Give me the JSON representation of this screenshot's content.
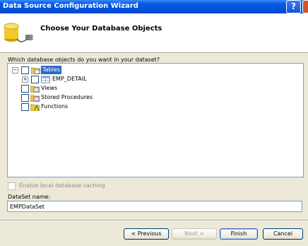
{
  "window": {
    "title": "Data Source Configuration Wizard",
    "help_glyph": "?",
    "close_glyph": "✕"
  },
  "header": {
    "heading": "Choose Your Database Objects",
    "icon": "database-plug-icon"
  },
  "tree": {
    "prompt": "Which database objects do you want in your dataset?",
    "nodes": [
      {
        "label": "Tables",
        "expander": "−",
        "icon": "tables-folder-icon",
        "selected": true
      },
      {
        "label": "EMP_DETAIL",
        "expander": "+",
        "icon": "table-icon"
      },
      {
        "label": "Views",
        "icon": "views-folder-icon"
      },
      {
        "label": "Stored Procedures",
        "icon": "procedures-folder-icon"
      },
      {
        "label": "Functions",
        "icon": "functions-folder-icon"
      }
    ]
  },
  "options": {
    "cache_label": "Enable local database caching",
    "dataset_label": "DataSet name:",
    "dataset_value": "EMPDataSet"
  },
  "buttons": {
    "previous": "< Previous",
    "next": "Next >",
    "finish": "Finish",
    "cancel": "Cancel"
  }
}
